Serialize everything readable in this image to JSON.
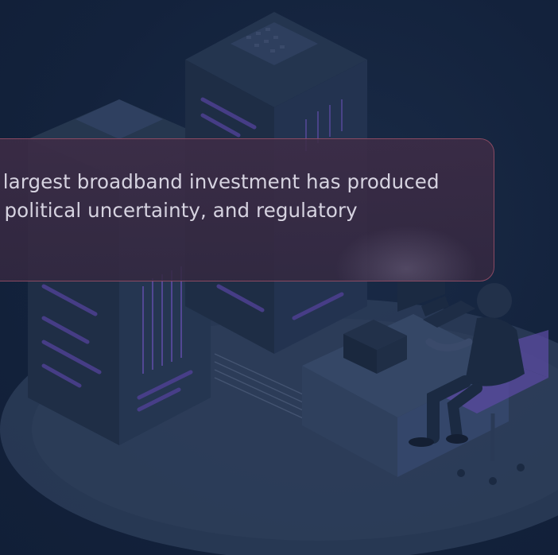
{
  "notice": {
    "lines": [
      "a's largest broadband investment has produced",
      "ce, political uncertainty, and regulatory"
    ]
  },
  "colors": {
    "background": "#13223c",
    "card_border": "#8a4a62",
    "card_fill": "#3b2c46",
    "text": "#d6d3e0",
    "accent": "#6b4fb0"
  },
  "icons": [
    "server-icon",
    "workstation-icon"
  ]
}
